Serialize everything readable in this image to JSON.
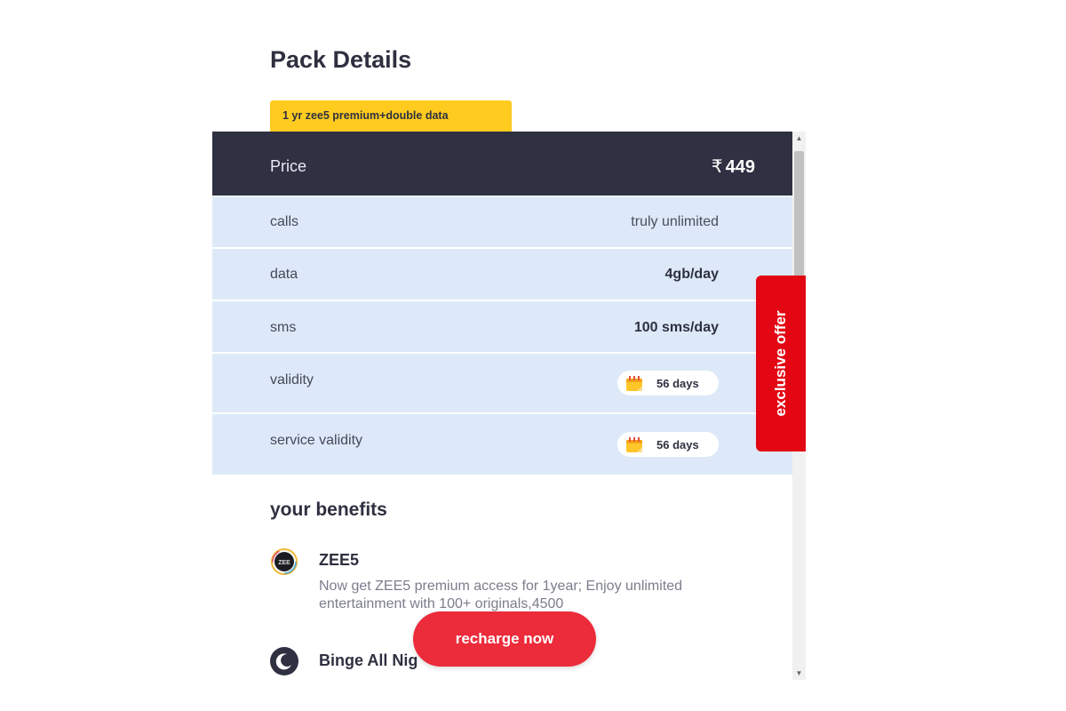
{
  "page": {
    "title": "Pack Details",
    "tag": "1 yr zee5 premium+double data"
  },
  "price": {
    "label": "Price",
    "currency": "₹",
    "amount": "449"
  },
  "details": [
    {
      "label": "calls",
      "value": "truly unlimited"
    },
    {
      "label": "data",
      "value": "4gb/day"
    },
    {
      "label": "sms",
      "value": "100 sms/day"
    },
    {
      "label": "validity",
      "value": "56 days",
      "icon": "calendar-icon"
    },
    {
      "label": "service validity",
      "value": "56 days",
      "icon": "calendar-icon"
    }
  ],
  "benefits": {
    "title": "your benefits",
    "items": [
      {
        "name": "ZEE5",
        "description": "Now get ZEE5 premium access for 1year; Enjoy unlimited entertainment with 100+ originals,4500",
        "icon": "zee5-logo-icon"
      },
      {
        "name": "Binge All Nig",
        "icon": "moon-icon"
      }
    ]
  },
  "actions": {
    "recharge_label": "recharge now"
  },
  "side_tab": {
    "label": "exclusive offer"
  },
  "colors": {
    "header_bg": "#2f3042",
    "row_bg": "#dde9f8",
    "tag_bg": "#ffcb1f",
    "accent_red": "#ec2b3b",
    "offer_red": "#e30613"
  }
}
